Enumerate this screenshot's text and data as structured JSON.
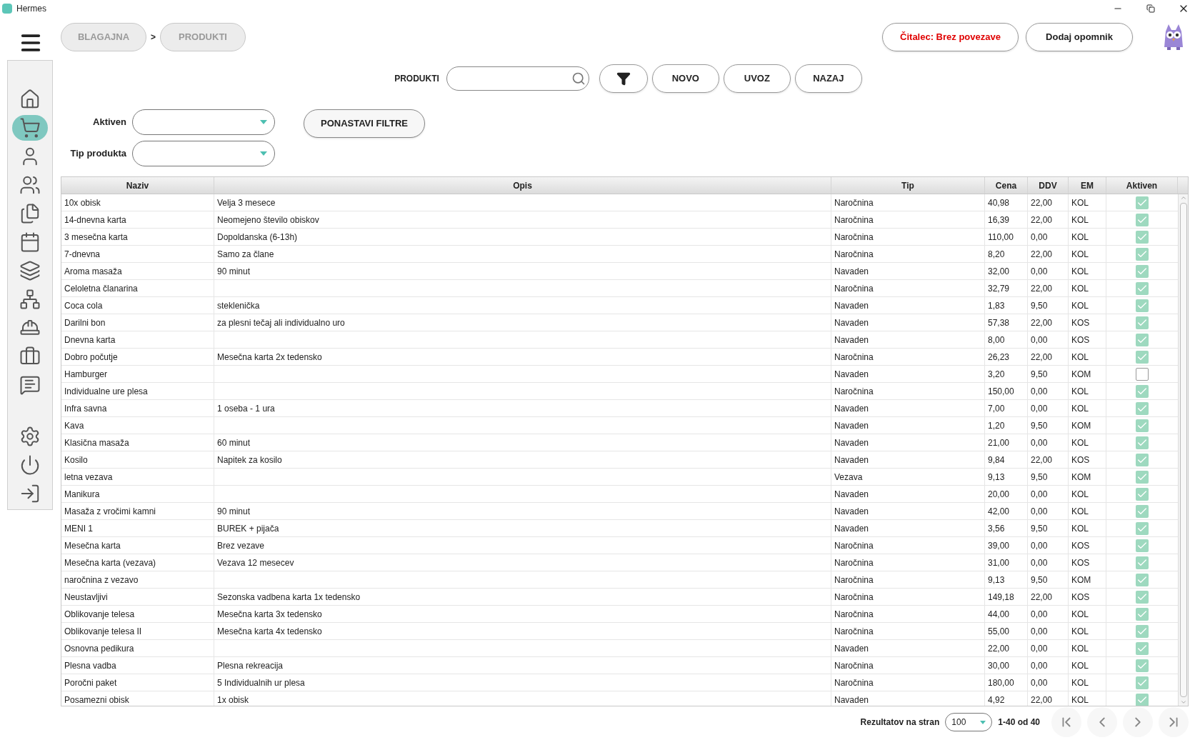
{
  "window": {
    "title": "Hermes"
  },
  "breadcrumb": [
    "BLAGAJNA",
    ">",
    "PRODUKTI"
  ],
  "header_buttons": [
    {
      "label": "Čitalec: Brez povezave",
      "kind": "alert"
    },
    {
      "label": "Dodaj opomnik",
      "kind": "normal"
    }
  ],
  "sidebar": {
    "items": [
      {
        "selected": false
      },
      {
        "selected": true
      },
      {
        "selected": false
      },
      {
        "selected": false
      },
      {
        "selected": false
      },
      {
        "selected": false
      },
      {
        "selected": false
      },
      {
        "selected": false
      },
      {
        "selected": false
      },
      {
        "selected": false
      },
      {
        "selected": false
      },
      {
        "selected": false
      },
      {
        "selected": false
      },
      {
        "selected": false
      }
    ]
  },
  "toolbar": {
    "search_label": "PRODUKTI",
    "buttons": [
      "NOVO",
      "UVOZ",
      "NAZAJ"
    ]
  },
  "filters": [
    {
      "label": "Aktiven"
    },
    {
      "label": "Tip produkta"
    }
  ],
  "reset_button": "PONASTAVI FILTRE",
  "table": {
    "columns": [
      "Naziv",
      "Opis",
      "Tip",
      "Cena",
      "DDV",
      "EM",
      "Aktiven"
    ],
    "rows": [
      {
        "naziv": "10x obisk",
        "opis": "Velja 3 mesece",
        "tip": "Naročnina",
        "cena": "40,98",
        "ddv": "22,00",
        "em": "KOL",
        "checked": true
      },
      {
        "naziv": "14-dnevna karta",
        "opis": "Neomejeno število obiskov",
        "tip": "Naročnina",
        "cena": "16,39",
        "ddv": "22,00",
        "em": "KOL",
        "checked": true
      },
      {
        "naziv": "3 mesečna karta",
        "opis": "Dopoldanska (6-13h)",
        "tip": "Naročnina",
        "cena": "110,00",
        "ddv": "0,00",
        "em": "KOL",
        "checked": true
      },
      {
        "naziv": "7-dnevna",
        "opis": "Samo za člane",
        "tip": "Naročnina",
        "cena": "8,20",
        "ddv": "22,00",
        "em": "KOL",
        "checked": true
      },
      {
        "naziv": "Aroma masaža",
        "opis": "90 minut",
        "tip": "Navaden",
        "cena": "32,00",
        "ddv": "0,00",
        "em": "KOL",
        "checked": true
      },
      {
        "naziv": "Celoletna članarina",
        "opis": "",
        "tip": "Naročnina",
        "cena": "32,79",
        "ddv": "22,00",
        "em": "KOL",
        "checked": true
      },
      {
        "naziv": "Coca cola",
        "opis": "steklenička",
        "tip": "Navaden",
        "cena": "1,83",
        "ddv": "9,50",
        "em": "KOL",
        "checked": true
      },
      {
        "naziv": "Darilni bon",
        "opis": "za plesni tečaj ali individualno uro",
        "tip": "Navaden",
        "cena": "57,38",
        "ddv": "22,00",
        "em": "KOS",
        "checked": true
      },
      {
        "naziv": "Dnevna karta",
        "opis": "",
        "tip": "Navaden",
        "cena": "8,00",
        "ddv": "0,00",
        "em": "KOS",
        "checked": true
      },
      {
        "naziv": "Dobro počutje",
        "opis": "Mesečna karta 2x tedensko",
        "tip": "Naročnina",
        "cena": "26,23",
        "ddv": "22,00",
        "em": "KOL",
        "checked": true
      },
      {
        "naziv": "Hamburger",
        "opis": "",
        "tip": "Navaden",
        "cena": "3,20",
        "ddv": "9,50",
        "em": "KOM",
        "checked": false
      },
      {
        "naziv": "Individualne ure plesa",
        "opis": "",
        "tip": "Naročnina",
        "cena": "150,00",
        "ddv": "0,00",
        "em": "KOL",
        "checked": true
      },
      {
        "naziv": "Infra savna",
        "opis": "1 oseba - 1 ura",
        "tip": "Navaden",
        "cena": "7,00",
        "ddv": "0,00",
        "em": "KOL",
        "checked": true
      },
      {
        "naziv": "Kava",
        "opis": "",
        "tip": "Navaden",
        "cena": "1,20",
        "ddv": "9,50",
        "em": "KOM",
        "checked": true
      },
      {
        "naziv": "Klasična masaža",
        "opis": "60 minut",
        "tip": "Navaden",
        "cena": "21,00",
        "ddv": "0,00",
        "em": "KOL",
        "checked": true
      },
      {
        "naziv": "Kosilo",
        "opis": "Napitek za kosilo",
        "tip": "Navaden",
        "cena": "9,84",
        "ddv": "22,00",
        "em": "KOS",
        "checked": true
      },
      {
        "naziv": "letna vezava",
        "opis": "",
        "tip": "Vezava",
        "cena": "9,13",
        "ddv": "9,50",
        "em": "KOM",
        "checked": true
      },
      {
        "naziv": "Manikura",
        "opis": "",
        "tip": "Navaden",
        "cena": "20,00",
        "ddv": "0,00",
        "em": "KOL",
        "checked": true
      },
      {
        "naziv": "Masaža z vročimi kamni",
        "opis": "90 minut",
        "tip": "Navaden",
        "cena": "42,00",
        "ddv": "0,00",
        "em": "KOL",
        "checked": true
      },
      {
        "naziv": "MENI 1",
        "opis": "BUREK + pijača",
        "tip": "Navaden",
        "cena": "3,56",
        "ddv": "9,50",
        "em": "KOL",
        "checked": true
      },
      {
        "naziv": "Mesečna karta",
        "opis": "Brez vezave",
        "tip": "Naročnina",
        "cena": "39,00",
        "ddv": "0,00",
        "em": "KOS",
        "checked": true
      },
      {
        "naziv": "Mesečna karta (vezava)",
        "opis": "Vezava 12 mesecev",
        "tip": "Naročnina",
        "cena": "31,00",
        "ddv": "0,00",
        "em": "KOS",
        "checked": true
      },
      {
        "naziv": "naročnina z vezavo",
        "opis": "",
        "tip": "Naročnina",
        "cena": "9,13",
        "ddv": "9,50",
        "em": "KOM",
        "checked": true
      },
      {
        "naziv": "Neustavljivi",
        "opis": "Sezonska vadbena karta 1x tedensko",
        "tip": "Naročnina",
        "cena": "149,18",
        "ddv": "22,00",
        "em": "KOS",
        "checked": true
      },
      {
        "naziv": "Oblikovanje telesa",
        "opis": "Mesečna karta 3x tedensko",
        "tip": "Naročnina",
        "cena": "44,00",
        "ddv": "0,00",
        "em": "KOL",
        "checked": true
      },
      {
        "naziv": "Oblikovanje telesa II",
        "opis": "Mesečna karta 4x tedensko",
        "tip": "Naročnina",
        "cena": "55,00",
        "ddv": "0,00",
        "em": "KOL",
        "checked": true
      },
      {
        "naziv": "Osnovna pedikura",
        "opis": "",
        "tip": "Navaden",
        "cena": "22,00",
        "ddv": "0,00",
        "em": "KOL",
        "checked": true
      },
      {
        "naziv": "Plesna vadba",
        "opis": "Plesna rekreacija",
        "tip": "Naročnina",
        "cena": "30,00",
        "ddv": "0,00",
        "em": "KOL",
        "checked": true
      },
      {
        "naziv": "Poročni paket",
        "opis": "5 Individualnih ur plesa",
        "tip": "Naročnina",
        "cena": "180,00",
        "ddv": "0,00",
        "em": "KOL",
        "checked": true
      },
      {
        "naziv": "Posamezni obisk",
        "opis": "1x obisk",
        "tip": "Navaden",
        "cena": "4,92",
        "ddv": "22,00",
        "em": "KOL",
        "checked": true
      }
    ]
  },
  "pagination": {
    "label": "Rezultatov na stran",
    "page_size": "100",
    "range": "1-40 od 40"
  }
}
